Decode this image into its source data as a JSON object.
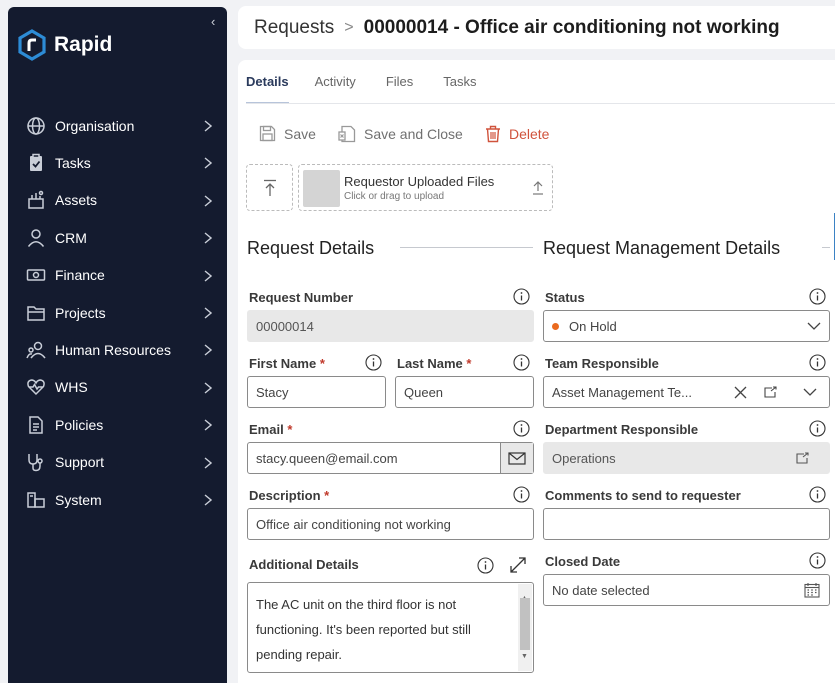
{
  "brand": {
    "name": "Rapid"
  },
  "sidebar": {
    "items": [
      {
        "label": "Organisation",
        "icon": "globe-icon"
      },
      {
        "label": "Tasks",
        "icon": "clipboard-check-icon"
      },
      {
        "label": "Assets",
        "icon": "assets-icon"
      },
      {
        "label": "CRM",
        "icon": "person-icon"
      },
      {
        "label": "Finance",
        "icon": "banknote-icon"
      },
      {
        "label": "Projects",
        "icon": "folder-icon"
      },
      {
        "label": "Human Resources",
        "icon": "people-icon"
      },
      {
        "label": "WHS",
        "icon": "heart-pulse-icon"
      },
      {
        "label": "Policies",
        "icon": "document-icon"
      },
      {
        "label": "Support",
        "icon": "stethoscope-icon"
      },
      {
        "label": "System",
        "icon": "system-icon"
      }
    ]
  },
  "breadcrumb": {
    "parent": "Requests",
    "separator": ">",
    "title": "00000014 - Office air conditioning not working"
  },
  "tabs": [
    "Details",
    "Activity",
    "Files",
    "Tasks"
  ],
  "toolbar": {
    "save": "Save",
    "save_close": "Save and Close",
    "delete": "Delete"
  },
  "upload": {
    "title": "Requestor Uploaded Files",
    "subtitle": "Click or drag to upload"
  },
  "sections": {
    "left": "Request Details",
    "right": "Request Management Details"
  },
  "form": {
    "request_number": {
      "label": "Request Number",
      "value": "00000014"
    },
    "first_name": {
      "label": "First Name",
      "value": "Stacy"
    },
    "last_name": {
      "label": "Last Name",
      "value": "Queen"
    },
    "email": {
      "label": "Email",
      "value": "stacy.queen@email.com"
    },
    "description": {
      "label": "Description",
      "value": "Office air conditioning not working"
    },
    "additional": {
      "label": "Additional Details",
      "value": "The AC unit on the third floor is not functioning. It's been reported but still pending repair."
    },
    "status": {
      "label": "Status",
      "value": "On Hold",
      "color": "#ea6a1e"
    },
    "team": {
      "label": "Team Responsible",
      "value": "Asset Management Te..."
    },
    "department": {
      "label": "Department Responsible",
      "value": "Operations"
    },
    "comments": {
      "label": "Comments to send to requester",
      "value": ""
    },
    "closed_date": {
      "label": "Closed Date",
      "placeholder": "No date selected"
    },
    "required_mark": "*"
  },
  "colors": {
    "sidebar_bg": "#141b2f",
    "accent": "#2d8cd6",
    "delete": "#d0533c"
  }
}
